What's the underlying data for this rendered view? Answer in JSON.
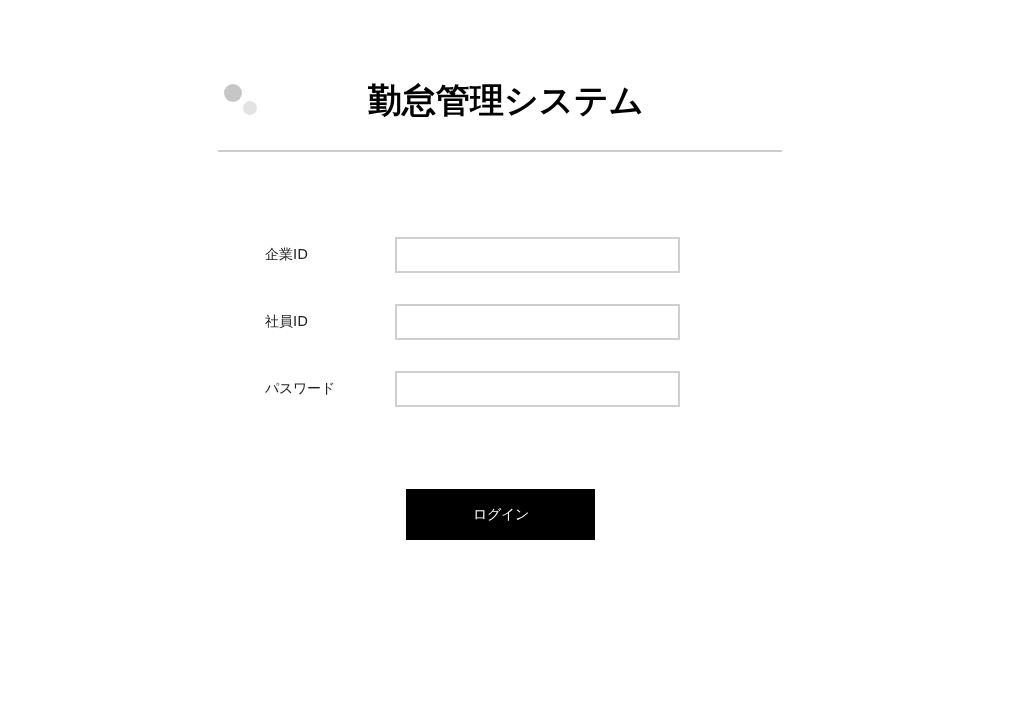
{
  "title": "勤怠管理システム",
  "fields": [
    {
      "label": "企業ID"
    },
    {
      "label": "社員ID"
    },
    {
      "label": "パスワード"
    }
  ],
  "login_button": "ログイン"
}
